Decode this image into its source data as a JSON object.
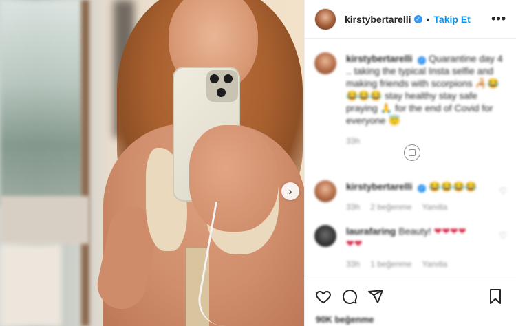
{
  "post": {
    "username": "kirstybertarelli",
    "verified_mark": "✓",
    "separator": "•",
    "follow_label": "Takip Et",
    "more_label": "•••",
    "next_label": "›"
  },
  "comments": [
    {
      "username": "kirstybertarelli",
      "verified_mark": "✓",
      "text": "Quarantine day 4 .. taking the typical Insta selfie and making friends with scorpions",
      "emoji_1": "🦂😂😂😂😂",
      "text_2": "stay healthy stay safe praying",
      "emoji_2": "🙏",
      "text_3": "for the end of Covid for everyone",
      "emoji_3": "😇",
      "time": "33h"
    },
    {
      "username": "kirstybertarelli",
      "verified_mark": "✓",
      "text": "😂😂😂😂",
      "time": "33h",
      "likes": "2 beğenme",
      "reply": "Yanıtla"
    },
    {
      "username": "laurafaring",
      "text": "Beauty!",
      "hearts": "❤❤❤❤",
      "hearts_2": "❤❤",
      "time": "33h",
      "likes": "1 beğenme",
      "reply": "Yanıtla"
    }
  ],
  "footer": {
    "likes": "90K beğenme"
  },
  "icons": {
    "like": "heart-icon",
    "comment": "comment-icon",
    "share": "share-icon",
    "save": "bookmark-icon",
    "small_like": "heart-icon"
  },
  "colors": {
    "accent": "#0095f6",
    "verified": "#3897f0",
    "meta": "#8e8e8e"
  }
}
